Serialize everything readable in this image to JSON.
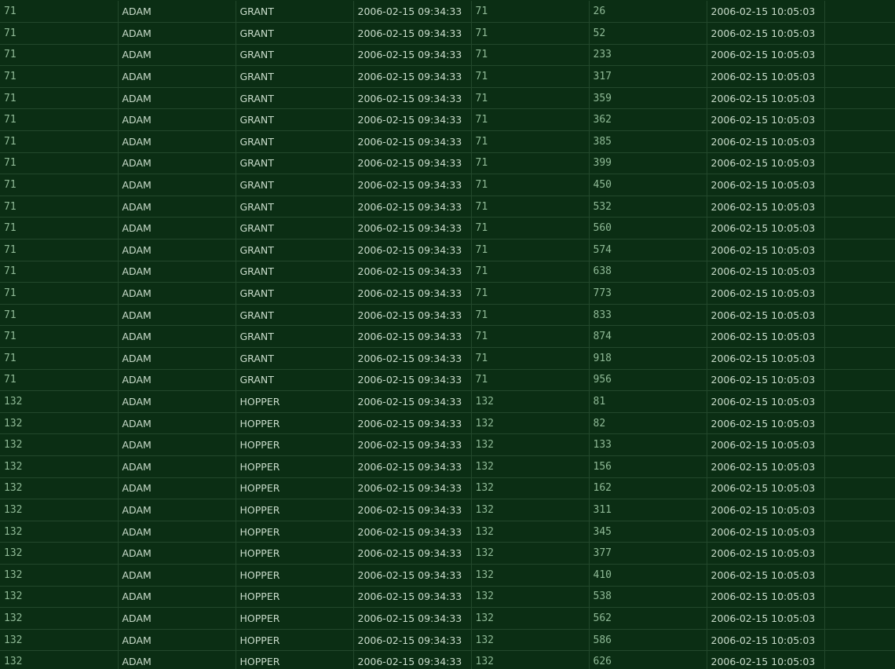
{
  "results_grid": {
    "rows": [
      [
        "71",
        "ADAM",
        "GRANT",
        "2006-02-15 09:34:33",
        "71",
        "26",
        "2006-02-15 10:05:03"
      ],
      [
        "71",
        "ADAM",
        "GRANT",
        "2006-02-15 09:34:33",
        "71",
        "52",
        "2006-02-15 10:05:03"
      ],
      [
        "71",
        "ADAM",
        "GRANT",
        "2006-02-15 09:34:33",
        "71",
        "233",
        "2006-02-15 10:05:03"
      ],
      [
        "71",
        "ADAM",
        "GRANT",
        "2006-02-15 09:34:33",
        "71",
        "317",
        "2006-02-15 10:05:03"
      ],
      [
        "71",
        "ADAM",
        "GRANT",
        "2006-02-15 09:34:33",
        "71",
        "359",
        "2006-02-15 10:05:03"
      ],
      [
        "71",
        "ADAM",
        "GRANT",
        "2006-02-15 09:34:33",
        "71",
        "362",
        "2006-02-15 10:05:03"
      ],
      [
        "71",
        "ADAM",
        "GRANT",
        "2006-02-15 09:34:33",
        "71",
        "385",
        "2006-02-15 10:05:03"
      ],
      [
        "71",
        "ADAM",
        "GRANT",
        "2006-02-15 09:34:33",
        "71",
        "399",
        "2006-02-15 10:05:03"
      ],
      [
        "71",
        "ADAM",
        "GRANT",
        "2006-02-15 09:34:33",
        "71",
        "450",
        "2006-02-15 10:05:03"
      ],
      [
        "71",
        "ADAM",
        "GRANT",
        "2006-02-15 09:34:33",
        "71",
        "532",
        "2006-02-15 10:05:03"
      ],
      [
        "71",
        "ADAM",
        "GRANT",
        "2006-02-15 09:34:33",
        "71",
        "560",
        "2006-02-15 10:05:03"
      ],
      [
        "71",
        "ADAM",
        "GRANT",
        "2006-02-15 09:34:33",
        "71",
        "574",
        "2006-02-15 10:05:03"
      ],
      [
        "71",
        "ADAM",
        "GRANT",
        "2006-02-15 09:34:33",
        "71",
        "638",
        "2006-02-15 10:05:03"
      ],
      [
        "71",
        "ADAM",
        "GRANT",
        "2006-02-15 09:34:33",
        "71",
        "773",
        "2006-02-15 10:05:03"
      ],
      [
        "71",
        "ADAM",
        "GRANT",
        "2006-02-15 09:34:33",
        "71",
        "833",
        "2006-02-15 10:05:03"
      ],
      [
        "71",
        "ADAM",
        "GRANT",
        "2006-02-15 09:34:33",
        "71",
        "874",
        "2006-02-15 10:05:03"
      ],
      [
        "71",
        "ADAM",
        "GRANT",
        "2006-02-15 09:34:33",
        "71",
        "918",
        "2006-02-15 10:05:03"
      ],
      [
        "71",
        "ADAM",
        "GRANT",
        "2006-02-15 09:34:33",
        "71",
        "956",
        "2006-02-15 10:05:03"
      ],
      [
        "132",
        "ADAM",
        "HOPPER",
        "2006-02-15 09:34:33",
        "132",
        "81",
        "2006-02-15 10:05:03"
      ],
      [
        "132",
        "ADAM",
        "HOPPER",
        "2006-02-15 09:34:33",
        "132",
        "82",
        "2006-02-15 10:05:03"
      ],
      [
        "132",
        "ADAM",
        "HOPPER",
        "2006-02-15 09:34:33",
        "132",
        "133",
        "2006-02-15 10:05:03"
      ],
      [
        "132",
        "ADAM",
        "HOPPER",
        "2006-02-15 09:34:33",
        "132",
        "156",
        "2006-02-15 10:05:03"
      ],
      [
        "132",
        "ADAM",
        "HOPPER",
        "2006-02-15 09:34:33",
        "132",
        "162",
        "2006-02-15 10:05:03"
      ],
      [
        "132",
        "ADAM",
        "HOPPER",
        "2006-02-15 09:34:33",
        "132",
        "311",
        "2006-02-15 10:05:03"
      ],
      [
        "132",
        "ADAM",
        "HOPPER",
        "2006-02-15 09:34:33",
        "132",
        "345",
        "2006-02-15 10:05:03"
      ],
      [
        "132",
        "ADAM",
        "HOPPER",
        "2006-02-15 09:34:33",
        "132",
        "377",
        "2006-02-15 10:05:03"
      ],
      [
        "132",
        "ADAM",
        "HOPPER",
        "2006-02-15 09:34:33",
        "132",
        "410",
        "2006-02-15 10:05:03"
      ],
      [
        "132",
        "ADAM",
        "HOPPER",
        "2006-02-15 09:34:33",
        "132",
        "538",
        "2006-02-15 10:05:03"
      ],
      [
        "132",
        "ADAM",
        "HOPPER",
        "2006-02-15 09:34:33",
        "132",
        "562",
        "2006-02-15 10:05:03"
      ],
      [
        "132",
        "ADAM",
        "HOPPER",
        "2006-02-15 09:34:33",
        "132",
        "586",
        "2006-02-15 10:05:03"
      ],
      [
        "132",
        "ADAM",
        "HOPPER",
        "2006-02-15 09:34:33",
        "132",
        "626",
        "2006-02-15 10:05:03"
      ]
    ]
  },
  "colors": {
    "background": "#0b2e14",
    "grid_line": "#23482c",
    "numeric_text": "#8fb996",
    "text": "#c9dccb"
  }
}
